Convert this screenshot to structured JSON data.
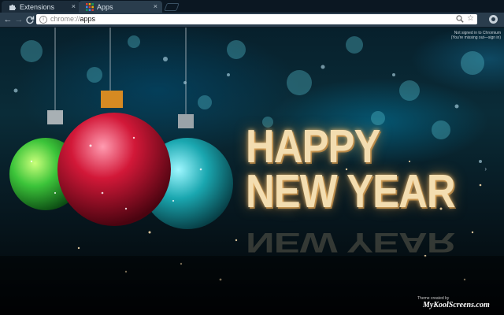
{
  "tabs": [
    {
      "title": "Extensions",
      "icon": "puzzle-icon",
      "active": false,
      "close": "×"
    },
    {
      "title": "Apps",
      "icon": "apps-grid-icon",
      "active": true,
      "close": "×"
    }
  ],
  "toolbar": {
    "back": "←",
    "forward": "→",
    "reload": "C",
    "url_scheme": "chrome://",
    "url_host": "apps",
    "star": "☆"
  },
  "signin": {
    "line1": "Not signed in to Chromium",
    "line2": "(You're missing out—sign in)"
  },
  "headline": {
    "line1": "HAPPY",
    "line2": "NEW YEAR"
  },
  "credit": {
    "label": "Theme created by",
    "site": "MyKoolScreens.com"
  },
  "colors": {
    "tab_strip": "#0b1722",
    "toolbar": "#2a3d4d",
    "ornament_green": "#3cc43a",
    "ornament_red": "#d21838",
    "ornament_teal": "#1aa7b0",
    "text_gold": "#f3ddb0"
  }
}
